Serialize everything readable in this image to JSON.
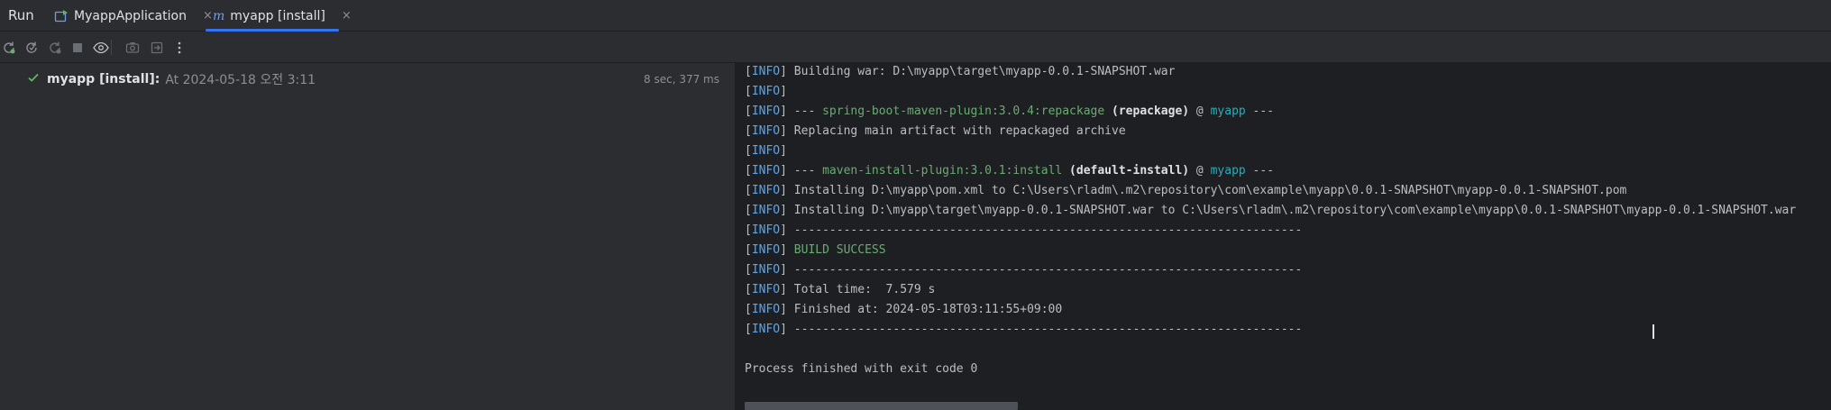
{
  "header": {
    "title": "Run",
    "tabs": [
      {
        "label": "MyappApplication",
        "icon": "run-config-icon",
        "active": false
      },
      {
        "label": "myapp [install]",
        "icon": "maven-icon",
        "active": true
      }
    ],
    "close_glyph": "×",
    "maven_glyph": "m"
  },
  "toolbar": {
    "buttons": [
      "rerun-icon",
      "rerun-failed-icon",
      "rerun-modified-icon",
      "stop-icon",
      "show-output-icon",
      "screenshot-icon",
      "export-icon",
      "more-icon"
    ]
  },
  "tree": {
    "item": {
      "name": "myapp [install]:",
      "time": "At 2024-05-18 오전 3:11",
      "duration": "8 sec, 377 ms",
      "status": "success"
    }
  },
  "console": {
    "lines": [
      {
        "tag": "INFO",
        "parts": [
          {
            "t": "Building war: D:\\myapp\\target\\myapp-0.0.1-SNAPSHOT.war",
            "s": ""
          }
        ]
      },
      {
        "tag": "INFO",
        "parts": []
      },
      {
        "tag": "INFO",
        "parts": [
          {
            "t": "--- ",
            "s": ""
          },
          {
            "t": "spring-boot-maven-plugin:3.0.4:repackage",
            "s": "plugin"
          },
          {
            "t": " ",
            "s": ""
          },
          {
            "t": "(repackage)",
            "s": "bold"
          },
          {
            "t": " @ ",
            "s": ""
          },
          {
            "t": "myapp",
            "s": "proj"
          },
          {
            "t": " ---",
            "s": ""
          }
        ]
      },
      {
        "tag": "INFO",
        "parts": [
          {
            "t": "Replacing main artifact with repackaged archive",
            "s": ""
          }
        ]
      },
      {
        "tag": "INFO",
        "parts": []
      },
      {
        "tag": "INFO",
        "parts": [
          {
            "t": "--- ",
            "s": ""
          },
          {
            "t": "maven-install-plugin:3.0.1:install",
            "s": "plugin"
          },
          {
            "t": " ",
            "s": ""
          },
          {
            "t": "(default-install)",
            "s": "bold"
          },
          {
            "t": " @ ",
            "s": ""
          },
          {
            "t": "myapp",
            "s": "proj"
          },
          {
            "t": " ---",
            "s": ""
          }
        ]
      },
      {
        "tag": "INFO",
        "parts": [
          {
            "t": "Installing D:\\myapp\\pom.xml to C:\\Users\\rladm\\.m2\\repository\\com\\example\\myapp\\0.0.1-SNAPSHOT\\myapp-0.0.1-SNAPSHOT.pom",
            "s": ""
          }
        ]
      },
      {
        "tag": "INFO",
        "parts": [
          {
            "t": "Installing D:\\myapp\\target\\myapp-0.0.1-SNAPSHOT.war to C:\\Users\\rladm\\.m2\\repository\\com\\example\\myapp\\0.0.1-SNAPSHOT\\myapp-0.0.1-SNAPSHOT.war",
            "s": ""
          }
        ]
      },
      {
        "tag": "INFO",
        "parts": [
          {
            "t": "------------------------------------------------------------------------",
            "s": ""
          }
        ]
      },
      {
        "tag": "INFO",
        "parts": [
          {
            "t": "BUILD SUCCESS",
            "s": "succ"
          }
        ]
      },
      {
        "tag": "INFO",
        "parts": [
          {
            "t": "------------------------------------------------------------------------",
            "s": ""
          }
        ]
      },
      {
        "tag": "INFO",
        "parts": [
          {
            "t": "Total time:  7.579 s",
            "s": ""
          }
        ]
      },
      {
        "tag": "INFO",
        "parts": [
          {
            "t": "Finished at: 2024-05-18T03:11:55+09:00",
            "s": ""
          }
        ]
      },
      {
        "tag": "INFO",
        "parts": [
          {
            "t": "------------------------------------------------------------------------",
            "s": ""
          }
        ]
      },
      {
        "tag": "",
        "parts": []
      },
      {
        "tag": "",
        "parts": [
          {
            "t": "Process finished with exit code 0",
            "s": ""
          }
        ]
      }
    ]
  },
  "colors": {
    "accent": "#3574f0",
    "info_tag": "#56a8f5",
    "plugin": "#6aab73",
    "project": "#2aacb8",
    "success_check": "#5fb865"
  }
}
